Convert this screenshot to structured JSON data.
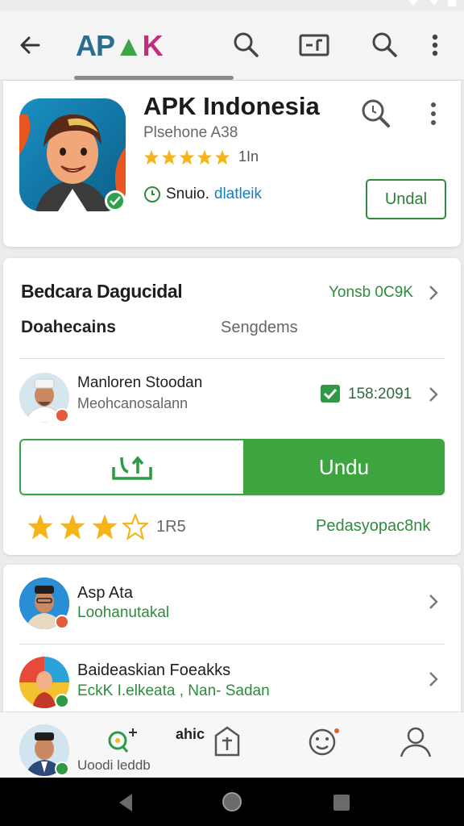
{
  "app_bar": {
    "logo": {
      "a": "AP",
      "p": "▲",
      "k": "K"
    },
    "icons": [
      "back-arrow-icon",
      "search-icon",
      "screen-icon",
      "search-icon",
      "more-vert-icon"
    ]
  },
  "header": {
    "title": "APK Indonesia",
    "subtitle": "Plsehone A38",
    "rating_count": "1In",
    "dev_prefix": "Snuio.",
    "dev_link": "dlatleik",
    "button": "Undal"
  },
  "section": {
    "title": "Bedcara Dagucidal",
    "right_link": "Yonsb 0C9K",
    "sub_left": "Doahecains",
    "sub_right": "Sengdems"
  },
  "release": {
    "name": "Manloren Stoodan",
    "subtitle": "Meohcanosalann",
    "date": "158:2091"
  },
  "download": {
    "label": "Undu"
  },
  "rating": {
    "stars": 3,
    "count": "1R5",
    "right_link": "Pedasyopac8nk"
  },
  "list": [
    {
      "name": "Asp Ata",
      "sub": "Loohanutakal"
    },
    {
      "name": "Baideaskian Foeakks",
      "sub": "EckK I.elkeata , Nan- Sadan"
    }
  ],
  "bottom_nav": {
    "label": "Uoodi leddb",
    "label2": "ahic"
  },
  "colors": {
    "accent_green": "#3da43f",
    "star_gold": "#f5b518",
    "link_blue": "#1a7fb8"
  }
}
